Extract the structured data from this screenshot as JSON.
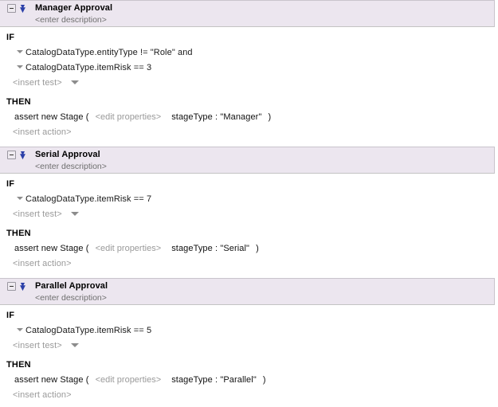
{
  "editor": {
    "name": "rules-editor",
    "header_bg": "#ece6ef",
    "body_bg": "#ffffff",
    "accent_blue": "#2b3fa8",
    "muted_text": "#9a9a9a"
  },
  "labels": {
    "if": "IF",
    "then": "THEN",
    "insert_test": "<insert test>",
    "insert_action": "<insert action>",
    "enter_description": "<enter description>",
    "edit_properties": "<edit properties>",
    "assert_prefix": "assert new Stage (",
    "close_paren": ")"
  },
  "rules": [
    {
      "title": "Manager Approval",
      "description": "<enter description>",
      "conditions": [
        "CatalogDataType.entityType  !=  \"Role\" and",
        "CatalogDataType.itemRisk  ==  3"
      ],
      "insert_test": "<insert test>",
      "action": {
        "prefix": "assert new Stage (",
        "edit": "<edit properties>",
        "body": "stageType : \"Manager\"",
        "suffix": ")"
      },
      "insert_action": "<insert action>"
    },
    {
      "title": "Serial Approval",
      "description": "<enter description>",
      "conditions": [
        "CatalogDataType.itemRisk  ==  7"
      ],
      "insert_test": "<insert test>",
      "action": {
        "prefix": "assert new Stage (",
        "edit": "<edit properties>",
        "body": "stageType : \"Serial\"",
        "suffix": ")"
      },
      "insert_action": "<insert action>"
    },
    {
      "title": "Parallel Approval",
      "description": "<enter description>",
      "conditions": [
        "CatalogDataType.itemRisk  ==  5"
      ],
      "insert_test": "<insert test>",
      "action": {
        "prefix": "assert new Stage (",
        "edit": "<edit properties>",
        "body": "stageType : \"Parallel\"",
        "suffix": ")"
      },
      "insert_action": "<insert action>"
    }
  ]
}
